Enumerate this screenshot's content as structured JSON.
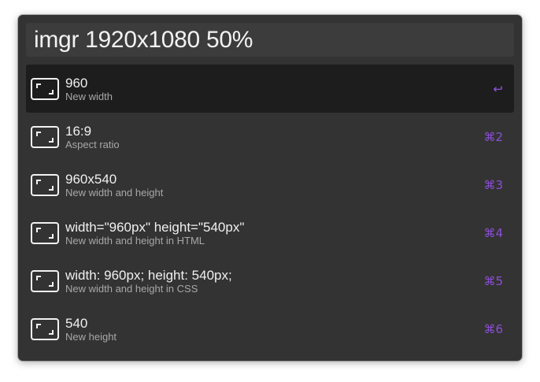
{
  "query": {
    "value": "imgr 1920x1080 50%"
  },
  "results": [
    {
      "title": "960",
      "subtitle": "New width",
      "shortcut": "↩",
      "icon": "resize-frame-icon"
    },
    {
      "title": "16:9",
      "subtitle": "Aspect ratio",
      "shortcut": "⌘2",
      "icon": "resize-frame-icon"
    },
    {
      "title": "960x540",
      "subtitle": "New width and height",
      "shortcut": "⌘3",
      "icon": "resize-frame-icon"
    },
    {
      "title": "width=\"960px\" height=\"540px\"",
      "subtitle": "New width and height in HTML",
      "shortcut": "⌘4",
      "icon": "resize-frame-icon"
    },
    {
      "title": "width: 960px; height: 540px;",
      "subtitle": "New width and height in CSS",
      "shortcut": "⌘5",
      "icon": "resize-frame-icon"
    },
    {
      "title": "540",
      "subtitle": "New height",
      "shortcut": "⌘6",
      "icon": "resize-frame-icon"
    }
  ],
  "colors": {
    "window_bg": "#333333",
    "query_bg": "#3c3c3c",
    "selected_row_bg": "#1d1d1d",
    "accent": "#8a4fd6",
    "title_text": "#f0f0f0",
    "subtitle_text": "#a8a8a8"
  }
}
